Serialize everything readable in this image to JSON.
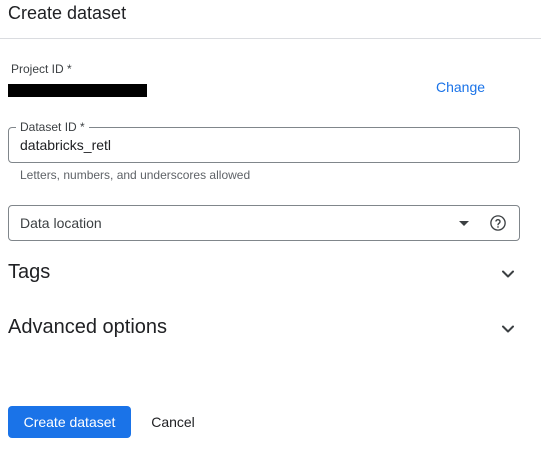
{
  "header": {
    "title": "Create dataset"
  },
  "project": {
    "label": "Project ID *",
    "change_label": "Change"
  },
  "dataset": {
    "label": "Dataset ID *",
    "value": "databricks_retl",
    "hint": "Letters, numbers, and underscores allowed"
  },
  "location": {
    "placeholder": "Data location",
    "icons": [
      "dropdown-arrow",
      "help-icon"
    ]
  },
  "sections": {
    "tags": "Tags",
    "advanced": "Advanced options"
  },
  "actions": {
    "create_label": "Create dataset",
    "cancel_label": "Cancel"
  },
  "colors": {
    "accent": "#1a73e8",
    "border": "#80868b",
    "text": "#202124"
  }
}
